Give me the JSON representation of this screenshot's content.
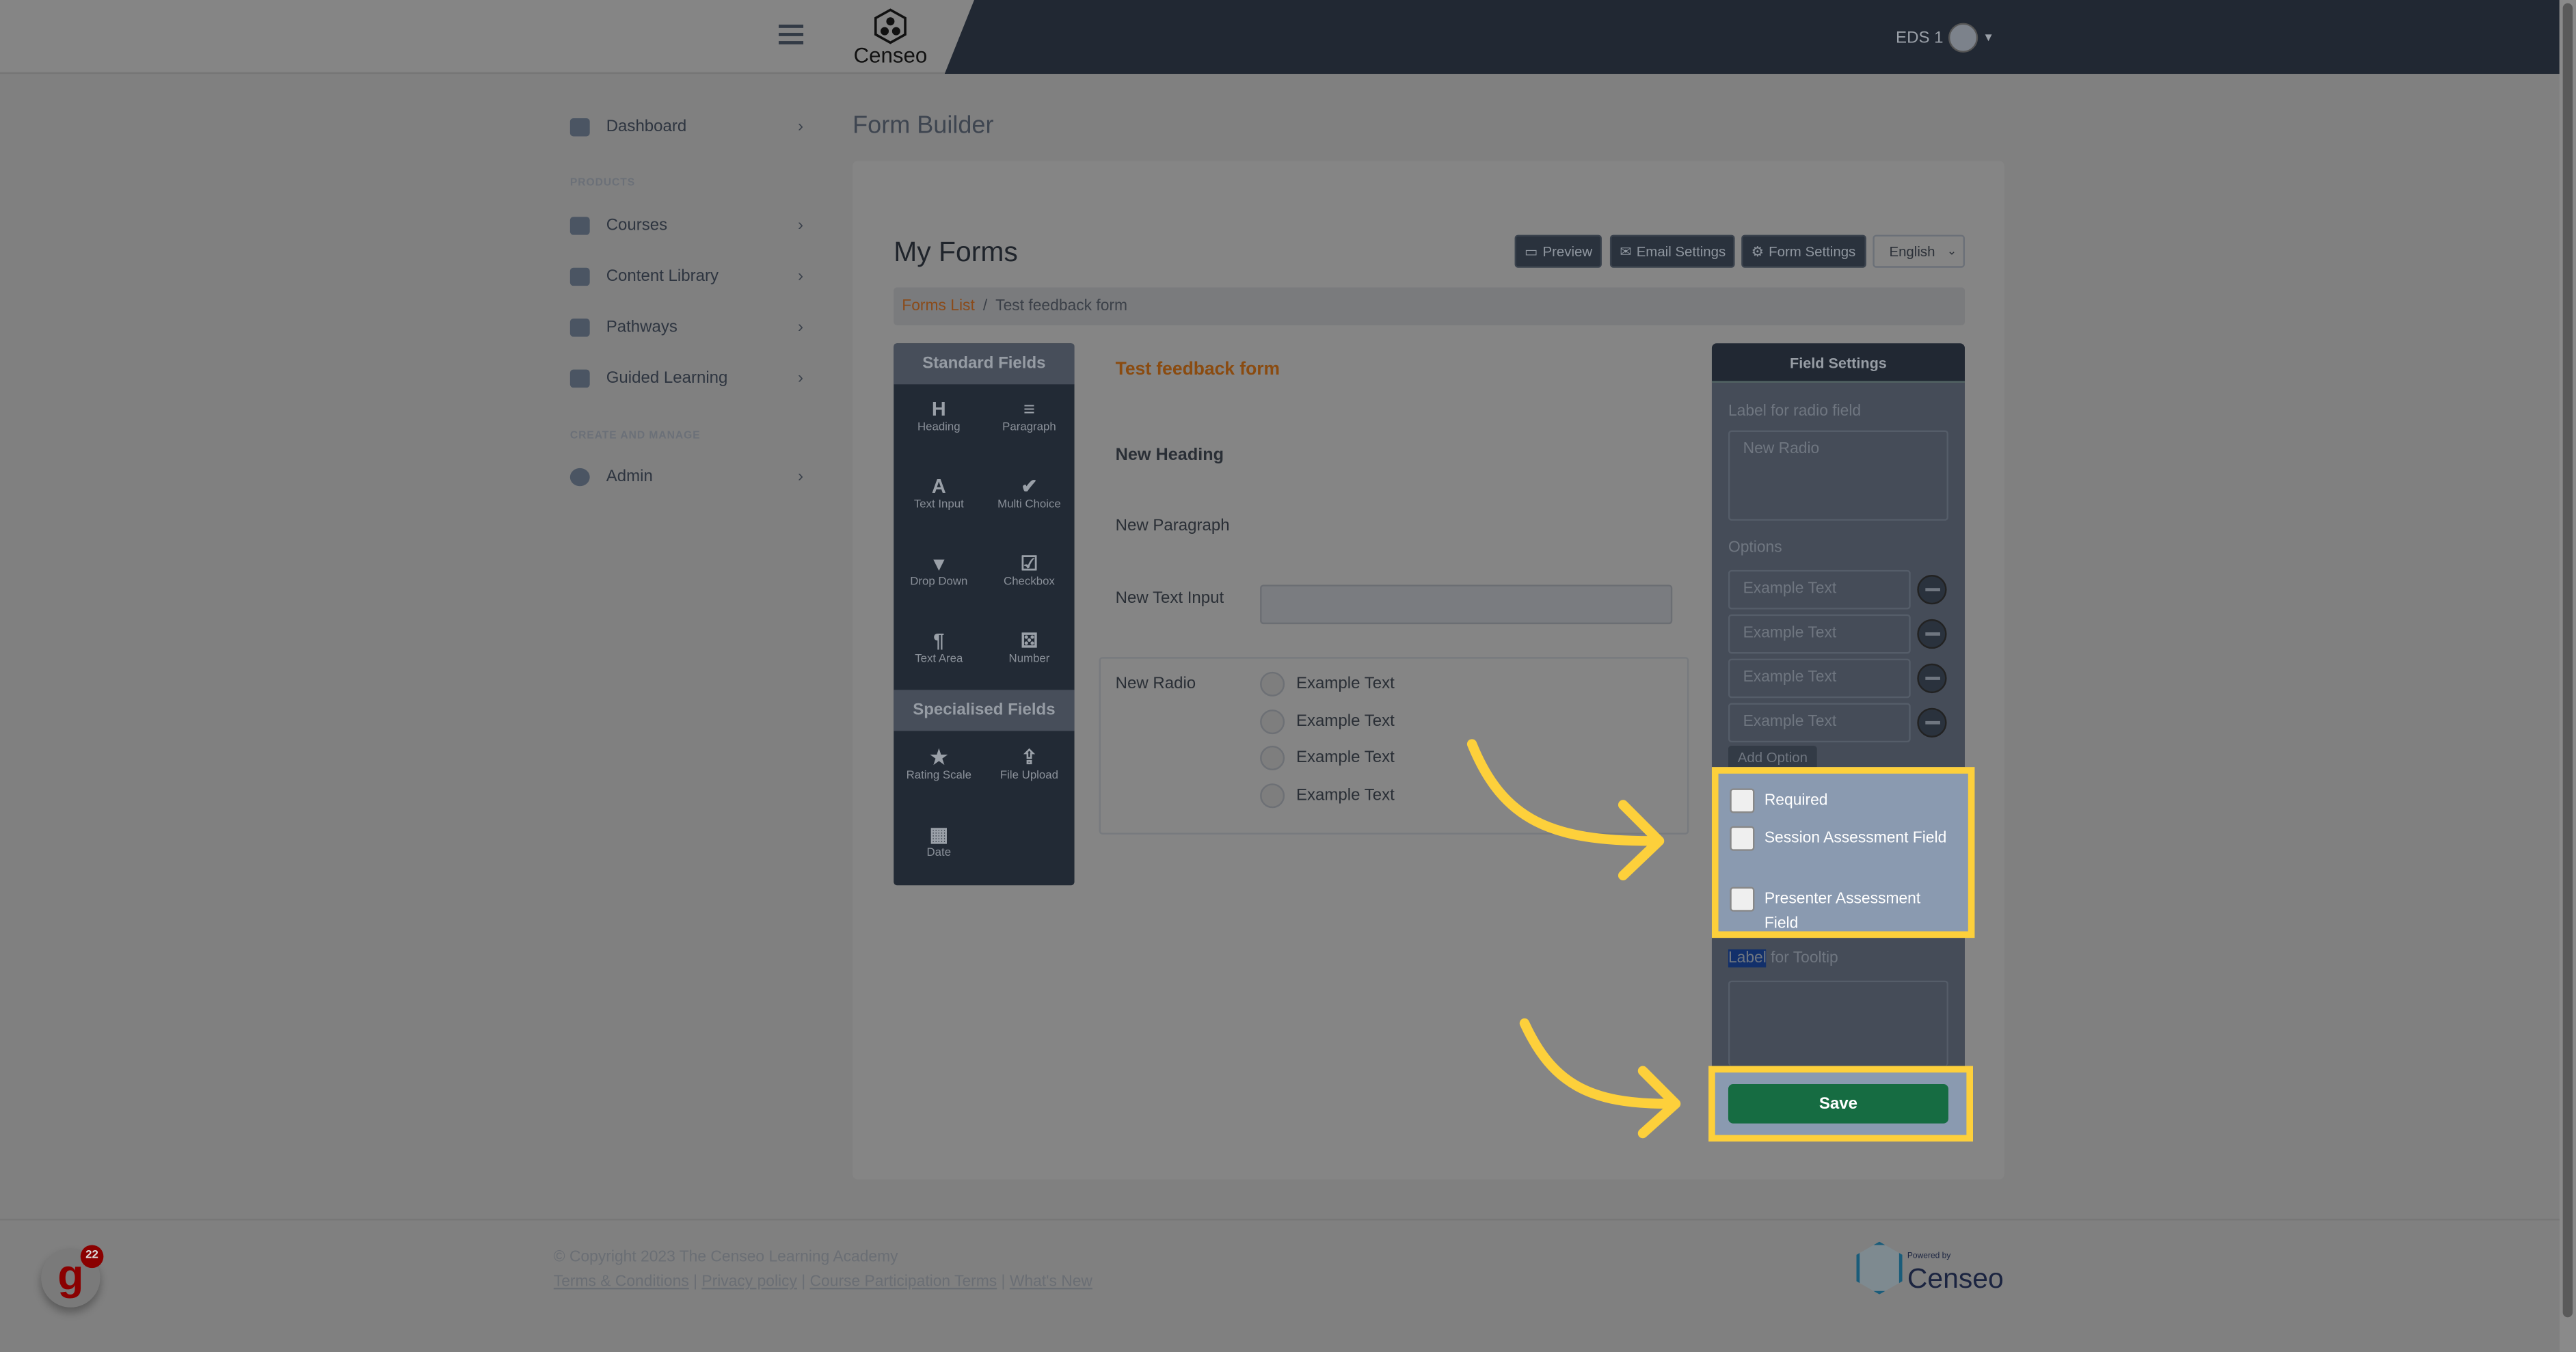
{
  "header": {
    "logo_text": "Censeo",
    "user": "EDS 1"
  },
  "sidebar": {
    "items": [
      {
        "label": "Dashboard"
      },
      {
        "label": "Courses"
      },
      {
        "label": "Content Library"
      },
      {
        "label": "Pathways"
      },
      {
        "label": "Guided Learning"
      },
      {
        "label": "Admin"
      }
    ],
    "sections": [
      "PRODUCTS",
      "CREATE AND MANAGE"
    ]
  },
  "page": {
    "title": "Form Builder",
    "card_title": "My Forms",
    "toolbar": {
      "preview": "Preview",
      "email": "Email Settings",
      "form_settings": "Form Settings",
      "language": "English"
    },
    "breadcrumb": {
      "link": "Forms List",
      "sep": "/",
      "current": "Test feedback form"
    }
  },
  "standard_fields": {
    "title": "Standard Fields",
    "tools": [
      {
        "label": "Heading",
        "glyph": "H"
      },
      {
        "label": "Paragraph",
        "glyph": "≡"
      },
      {
        "label": "Text Input",
        "glyph": "A"
      },
      {
        "label": "Multi Choice",
        "glyph": "✔"
      },
      {
        "label": "Drop Down",
        "glyph": "▾"
      },
      {
        "label": "Checkbox",
        "glyph": "☑"
      },
      {
        "label": "Text Area",
        "glyph": "¶"
      },
      {
        "label": "Number",
        "glyph": "⚄"
      }
    ]
  },
  "specialised_fields": {
    "title": "Specialised Fields",
    "tools": [
      {
        "label": "Rating Scale",
        "glyph": "★"
      },
      {
        "label": "File Upload",
        "glyph": "⇪"
      },
      {
        "label": "Date",
        "glyph": "▦"
      }
    ]
  },
  "form": {
    "title": "Test feedback form",
    "heading": "New Heading",
    "paragraph": "New Paragraph",
    "text_input_label": "New Text Input",
    "radio_label": "New Radio",
    "radio_options": [
      "Example Text",
      "Example Text",
      "Example Text",
      "Example Text"
    ]
  },
  "field_settings": {
    "title": "Field Settings",
    "label_caption": "Label for radio field",
    "label_value": "New Radio",
    "options_caption": "Options",
    "options": [
      "Example Text",
      "Example Text",
      "Example Text",
      "Example Text"
    ],
    "add_option": "Add Option",
    "checkboxes": [
      {
        "label": "Required",
        "checked": false
      },
      {
        "label": "Session Assessment Field",
        "checked": false
      },
      {
        "label": "Presenter Assessment Field",
        "checked": false
      }
    ],
    "tooltip_caption_selected": "Label",
    "tooltip_caption_rest": " for Tooltip",
    "save": "Save"
  },
  "footer": {
    "copyright": "© Copyright 2023 The Censeo Learning Academy",
    "links": [
      "Terms & Conditions",
      "Privacy policy",
      "Course Participation Terms",
      "What's New"
    ],
    "powered_by": "Powered by",
    "powered_logo": "Censeo",
    "widget": "g",
    "widget_badge": "22"
  },
  "colors": {
    "highlight": "#fdd03b",
    "save": "#166c42",
    "accent": "#8a4b10"
  }
}
